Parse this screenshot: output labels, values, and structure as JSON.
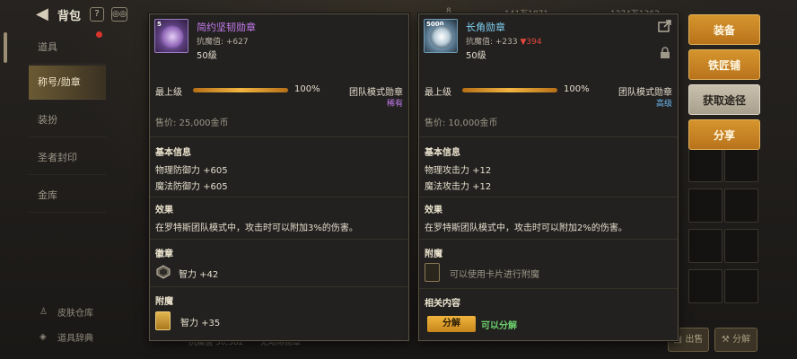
{
  "topbar": {
    "title": "背包",
    "help_label": "?",
    "counter_a": "8",
    "currency_a": "141万1871",
    "currency_b": "1274万1362"
  },
  "sidebar": {
    "items": [
      {
        "label": "道具",
        "active": false
      },
      {
        "label": "称号/勋章",
        "active": true
      },
      {
        "label": "装扮",
        "active": false
      },
      {
        "label": "圣者封印",
        "active": false
      },
      {
        "label": "金库",
        "active": false
      }
    ],
    "footer": [
      {
        "label": "皮肤仓库"
      },
      {
        "label": "道具辞典"
      }
    ]
  },
  "actions": {
    "equip": "装备",
    "smith": "铁匠铺",
    "obtain": "获取途径",
    "share": "分享",
    "sell": "出售",
    "decompose": "分解"
  },
  "left_card": {
    "icon_tag": "5",
    "name": "简约坚韧勋章",
    "name_color": "#c57cf0",
    "resist_label": "抗魔值: +627",
    "level_req": "50级",
    "level_title": "最上级",
    "level_percent": 1.0,
    "level_percent_label": "100%",
    "type": "团队模式勋章",
    "rarity": "稀有",
    "rarity_color": "#c57cf0",
    "price": "售价: 25,000金币",
    "basic_title": "基本信息",
    "stats": [
      "物理防御力 +605",
      "魔法防御力 +605"
    ],
    "effect_title": "效果",
    "effect_text": "在罗特斯团队模式中，攻击时可以附加3%的伤害。",
    "emblem_title": "徽章",
    "emblem_icon": "shield-gem-icon",
    "emblem_stat": "智力 +42",
    "enchant_title": "附魔",
    "enchant_stat": "智力 +35"
  },
  "right_card": {
    "icon_tag": "5000",
    "name": "长角勋章",
    "name_color": "#7fd1f2",
    "resist_prefix": "抗魔值: +233 ",
    "resist_change": "▼394",
    "level_req": "50级",
    "level_title": "最上级",
    "level_percent": 1.0,
    "level_percent_label": "100%",
    "type": "团队模式勋章",
    "rarity": "高级",
    "rarity_color": "#6ab7f0",
    "price": "售价: 10,000金币",
    "basic_title": "基本信息",
    "stats": [
      "物理攻击力 +12",
      "魔法攻击力 +12"
    ],
    "effect_title": "效果",
    "effect_text": "在罗特斯团队模式中，攻击时可以附加2%的伤害。",
    "enchant_title": "附魔",
    "enchant_hint": "可以使用卡片进行附魔",
    "related_title": "相关内容",
    "decompose_btn": "分解",
    "decompose_status": "可以分解"
  },
  "bottom": {
    "left_text": "抗魔值 30,382",
    "mid_text": "无动际勋章"
  }
}
